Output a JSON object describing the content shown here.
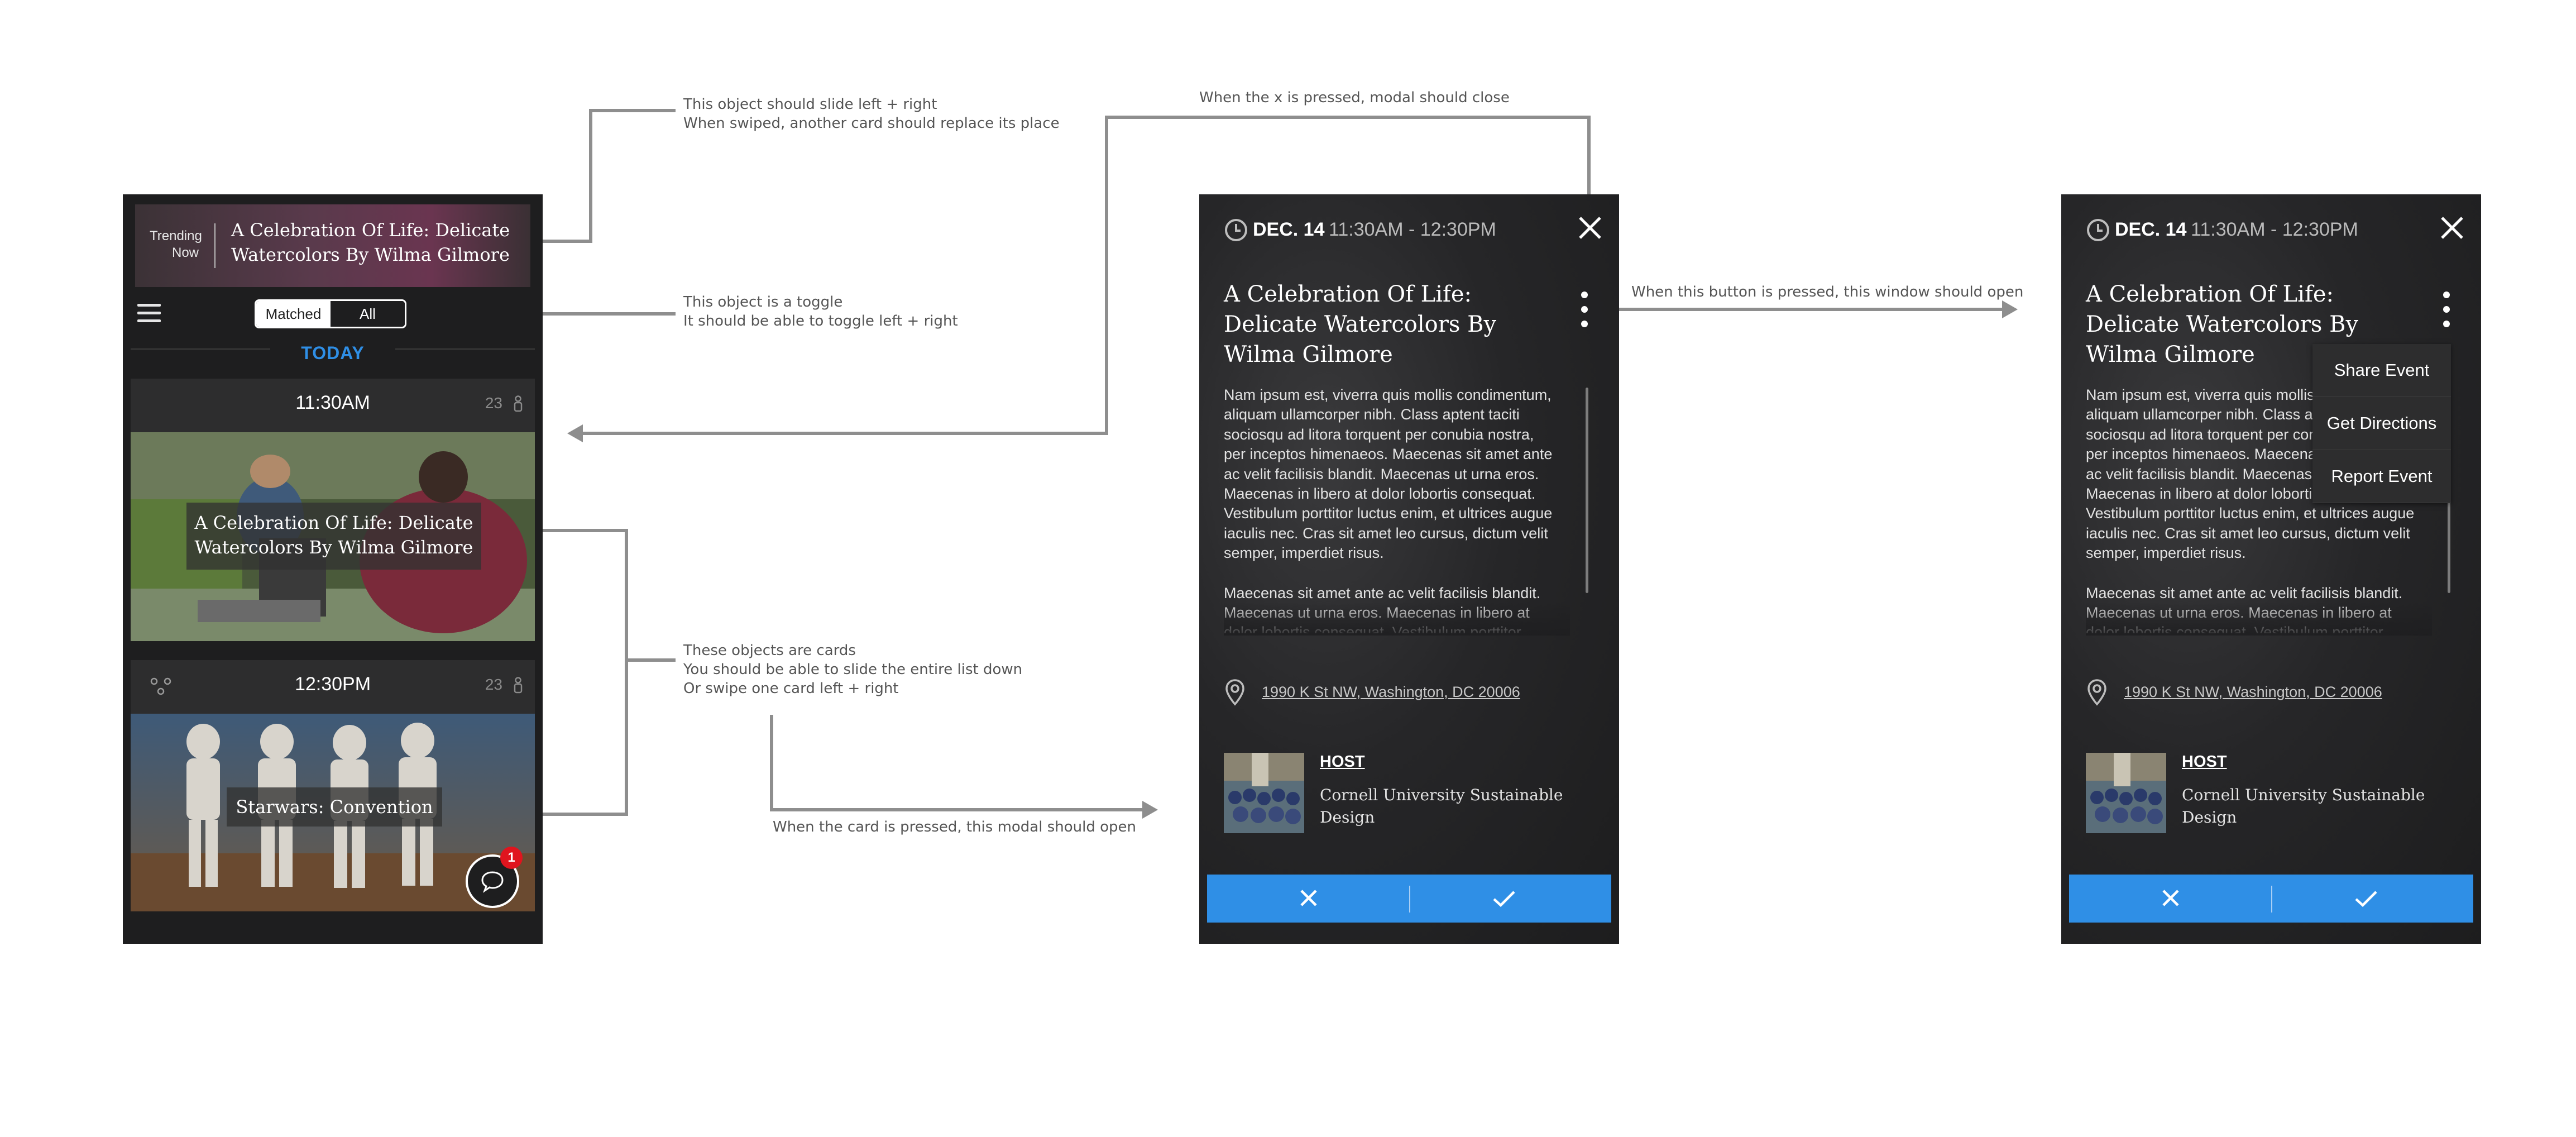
{
  "annotations": {
    "slide_card": [
      "This object should slide left + right",
      "When swiped, another card should replace its place"
    ],
    "toggle": [
      "This object is a toggle",
      "It should be able to toggle left + right"
    ],
    "cards": [
      "These objects are cards",
      "You should be able to slide the entire list down",
      "Or swipe one card left + right"
    ],
    "card_press": "When the card is pressed, this modal should open",
    "x_press": "When the x is pressed, modal should close",
    "button_press": "When this button is pressed, this window should open"
  },
  "feed": {
    "trending_label_1": "Trending",
    "trending_label_2": "Now",
    "trending_title": "A Celebration Of Life: Delicate Watercolors By Wilma Gilmore",
    "toggle": {
      "matched": "Matched",
      "all": "All",
      "selected": "All"
    },
    "section_label": "TODAY",
    "cards": [
      {
        "time": "11:30AM",
        "count": "23",
        "title": "A Celebration Of Life: Delicate Watercolors By Wilma Gilmore"
      },
      {
        "time": "12:30PM",
        "count": "23",
        "title": "Starwars: Convention"
      }
    ],
    "chat_badge": "1"
  },
  "modal": {
    "date": "DEC. 14",
    "time": "11:30AM - 12:30PM",
    "title": "A Celebration Of Life: Delicate Watercolors By Wilma Gilmore",
    "description": [
      "Nam ipsum est, viverra quis mollis condimentum, aliquam ullamcorper nibh. Class aptent taciti sociosqu ad litora torquent per conubia nostra, per inceptos himenaeos. Maecenas sit amet ante ac velit facilisis blandit. Maecenas ut urna eros. Maecenas in libero at dolor lobortis consequat. Vestibulum porttitor luctus enim, et ultrices augue iaculis nec. Cras sit amet leo cursus, dictum velit semper, imperdiet risus.",
      "Maecenas sit amet ante ac velit facilisis blandit. Maecenas ut urna eros. Maecenas in libero at dolor lobortis consequat. Vestibulum porttitor luctus"
    ],
    "address": "1990 K St NW, Washington, DC 20006",
    "host_label": "HOST",
    "host_name": "Cornell University Sustainable Design",
    "menu": [
      "Share Event",
      "Get Directions",
      "Report Event"
    ]
  },
  "colors": {
    "accent": "#2f8fe6",
    "badge": "#e0141e",
    "background": "#1e1e1f"
  }
}
